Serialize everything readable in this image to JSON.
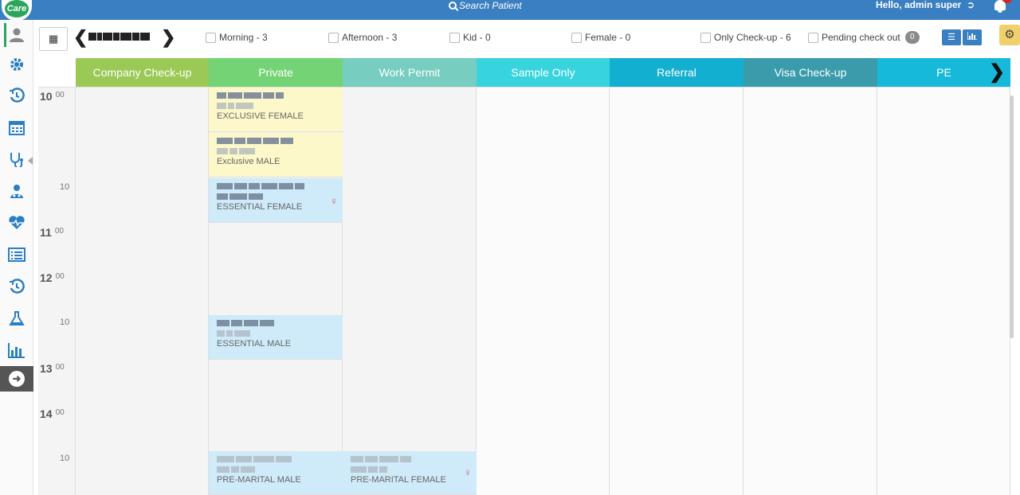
{
  "app": {
    "logo_text": "Care",
    "search_placeholder": "Search Patient",
    "greeting": "Hello, admin super"
  },
  "toolbar": {
    "filters": [
      {
        "label": "Morning - 3"
      },
      {
        "label": "Afternoon - 3"
      },
      {
        "label": "Kid - 0"
      },
      {
        "label": "Female - 0"
      },
      {
        "label": "Only Check-up - 6"
      },
      {
        "label": "Pending check out",
        "badge": "0"
      }
    ]
  },
  "sidebar": {
    "items": [
      "user-icon",
      "settings-icon",
      "history-icon",
      "calendar-icon",
      "stethoscope-icon",
      "doctor-icon",
      "heartbeat-icon",
      "list-icon",
      "history-icon",
      "flask-icon",
      "bar-chart-icon",
      "arrow-right-icon"
    ]
  },
  "columns": [
    {
      "label": "Company Check-up",
      "color": "#9bc955"
    },
    {
      "label": "Private",
      "color": "#74d374"
    },
    {
      "label": "Work Permit",
      "color": "#77cdbf"
    },
    {
      "label": "Sample Only",
      "color": "#38d4dd"
    },
    {
      "label": "Referral",
      "color": "#13afd0"
    },
    {
      "label": "Visa Check-up",
      "color": "#3a9cab"
    },
    {
      "label": "PE",
      "color": "#17b9da"
    }
  ],
  "time_labels": {
    "h10": "10",
    "m10": "00",
    "h10_10": "10",
    "h11": "11",
    "m11": "00",
    "h12": "12",
    "m12": "00",
    "h12_10": "10",
    "h13": "13",
    "m13": "00",
    "h14": "14",
    "m14": "00",
    "h14_10": "10"
  },
  "appointments": [
    {
      "package": "EXCLUSIVE FEMALE"
    },
    {
      "package": "Exclusive MALE"
    },
    {
      "package": "ESSENTIAL FEMALE"
    },
    {
      "package": "ESSENTIAL MALE"
    },
    {
      "package": "PRE-MARITAL MALE"
    },
    {
      "package": "PRE-MARITAL FEMALE"
    }
  ]
}
